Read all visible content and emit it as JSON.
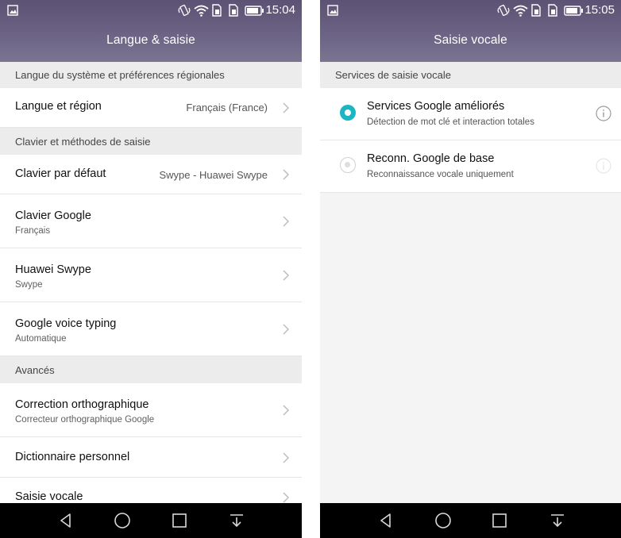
{
  "left_screen": {
    "status": {
      "time": "15:04"
    },
    "title": "Langue & saisie",
    "sections": {
      "s1": "Langue du système et préférences régionales",
      "s2": "Clavier et méthodes de saisie",
      "s3": "Avancés"
    },
    "rows": {
      "langue": {
        "title": "Langue et région",
        "value": "Français (France)"
      },
      "clavier_defaut": {
        "title": "Clavier par défaut",
        "value": "Swype - Huawei Swype"
      },
      "clavier_google": {
        "title": "Clavier Google",
        "sub": "Français"
      },
      "huawei_swype": {
        "title": "Huawei Swype",
        "sub": "Swype"
      },
      "voice_typing": {
        "title": "Google voice typing",
        "sub": "Automatique"
      },
      "correction": {
        "title": "Correction orthographique",
        "sub": "Correcteur orthographique Google"
      },
      "dictionnaire": {
        "title": "Dictionnaire personnel"
      },
      "saisie_vocale": {
        "title": "Saisie vocale"
      }
    }
  },
  "right_screen": {
    "status": {
      "time": "15:05"
    },
    "title": "Saisie vocale",
    "section": "Services de saisie vocale",
    "options": [
      {
        "title": "Services Google améliorés",
        "sub": "Détection de mot clé et interaction totales",
        "selected": true
      },
      {
        "title": "Reconn. Google de base",
        "sub": "Reconnaissance vocale uniquement",
        "selected": false
      }
    ]
  },
  "colors": {
    "accent": "#1bb6c4",
    "appbar": "#625a7c",
    "navbar": "#000000"
  },
  "icons": [
    "gallery-icon",
    "vibrate-icon",
    "wifi-icon",
    "sim-icon",
    "battery-icon",
    "chevron-right-icon",
    "info-icon",
    "back-icon",
    "home-icon",
    "recents-icon",
    "notification-down-icon"
  ]
}
